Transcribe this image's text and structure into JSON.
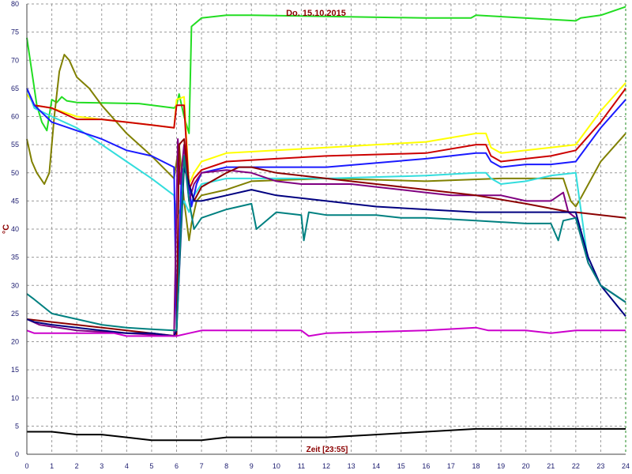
{
  "chart_data": {
    "type": "line",
    "title": "Do. 15.10.2015",
    "xlabel": "Zeit [23:55]",
    "ylabel": "°C",
    "xlim": [
      0,
      24
    ],
    "ylim": [
      0,
      80
    ],
    "xticks": [
      "0",
      "1",
      "2",
      "3",
      "4",
      "5",
      "6",
      "7",
      "8",
      "9",
      "10",
      "11",
      "12",
      "13",
      "14",
      "15",
      "16",
      "17",
      "18",
      "19",
      "20",
      "21",
      "22",
      "23",
      "24"
    ],
    "yticks": [
      "0",
      "5",
      "10",
      "15",
      "20",
      "25",
      "30",
      "35",
      "40",
      "45",
      "50",
      "55",
      "60",
      "65",
      "70",
      "75",
      "80"
    ],
    "grid": true,
    "series": [
      {
        "color": "#22dd22",
        "x": [
          0,
          0.2,
          0.4,
          0.6,
          0.8,
          1,
          1.2,
          1.4,
          1.6,
          2,
          4.5,
          5.9,
          6.0,
          6.1,
          6.3,
          6.5,
          6.6,
          7,
          8,
          9,
          16,
          17.8,
          18,
          22,
          22.2,
          23,
          24
        ],
        "y": [
          74,
          68,
          62,
          59,
          57.5,
          63,
          62.5,
          63.5,
          62.8,
          62.5,
          62.3,
          61.5,
          62,
          64,
          60,
          57,
          76,
          77.5,
          78,
          78,
          77.5,
          77.5,
          78,
          77,
          77.5,
          78,
          79.5
        ]
      },
      {
        "color": "#808000",
        "x": [
          0,
          0.2,
          0.4,
          0.7,
          0.9,
          1.1,
          1.3,
          1.5,
          1.7,
          2,
          2.5,
          3,
          4,
          5,
          5.9,
          6.1,
          6.3,
          6.5,
          6.6,
          6.8,
          7,
          8,
          9,
          12,
          16,
          19,
          21.5,
          21.8,
          22,
          22.2,
          23,
          24
        ],
        "y": [
          56,
          52,
          50,
          48,
          50,
          60,
          68,
          71,
          70,
          67,
          65,
          62,
          57,
          53,
          49,
          55,
          45,
          38,
          41,
          45,
          46,
          47,
          48.5,
          49,
          48.5,
          49,
          49,
          45,
          44,
          45.5,
          52,
          57
        ]
      },
      {
        "color": "#ffff00",
        "x": [
          0,
          0.3,
          1,
          2,
          3,
          4,
          5,
          5.9,
          6.0,
          6.3,
          6.5,
          6.7,
          7,
          8,
          10,
          12,
          16,
          18,
          18.4,
          18.6,
          19,
          20,
          21,
          22,
          23,
          24
        ],
        "y": [
          64,
          62,
          61.5,
          60,
          59.5,
          59,
          58.5,
          58,
          63,
          63.5,
          48,
          50,
          52,
          53.5,
          54,
          54.5,
          55.5,
          57,
          57,
          54.5,
          53.5,
          54,
          54.5,
          55,
          61,
          66
        ]
      },
      {
        "color": "#cc0000",
        "x": [
          0,
          0.3,
          1,
          2,
          3,
          4,
          5,
          5.9,
          6.0,
          6.3,
          6.5,
          6.7,
          7,
          8,
          10,
          12,
          16,
          18,
          18.4,
          18.6,
          19,
          20,
          21,
          22,
          23,
          24
        ],
        "y": [
          65,
          62,
          61.5,
          59.5,
          59.5,
          59,
          58.5,
          58,
          62,
          62,
          47,
          49,
          50.5,
          52,
          52.5,
          53,
          53.5,
          55,
          55,
          53,
          52,
          52.5,
          53,
          54,
          59,
          65
        ]
      },
      {
        "color": "#33dddd",
        "x": [
          0,
          0.3,
          1,
          2,
          3,
          4,
          5,
          5.9,
          6.0,
          6.3,
          6.5,
          6.7,
          7,
          8,
          10,
          12,
          16,
          18,
          18.4,
          18.6,
          19,
          20,
          21,
          22,
          22.5,
          23,
          24
        ],
        "y": [
          65,
          61.5,
          60,
          58,
          55,
          52,
          49,
          46,
          42,
          45,
          43,
          46,
          48,
          49,
          49,
          49,
          49.5,
          50,
          50,
          49,
          48,
          48.5,
          49.5,
          50,
          34,
          30,
          27
        ]
      },
      {
        "color": "#1a1aff",
        "x": [
          0,
          0.3,
          1,
          2,
          3,
          4,
          5,
          5.9,
          6.0,
          6.2,
          6.4,
          6.6,
          6.8,
          7,
          8,
          10,
          12,
          16,
          18,
          18.4,
          18.6,
          19,
          20,
          21,
          22,
          23,
          24
        ],
        "y": [
          65,
          62,
          59,
          57.5,
          56,
          54,
          53,
          51,
          22,
          50,
          52,
          44,
          48,
          50,
          51,
          51,
          51,
          52.5,
          53.5,
          53.5,
          52,
          51,
          51.5,
          51.5,
          52,
          58,
          63
        ]
      },
      {
        "color": "#800080",
        "x": [
          0,
          0.5,
          2,
          4,
          5.9,
          6.05,
          6.15,
          6.3,
          6.5,
          6.7,
          7,
          8,
          9,
          10,
          11,
          12,
          13,
          14,
          15,
          16,
          17,
          18,
          19,
          20,
          21,
          21.5,
          21.7,
          22,
          22.5,
          23,
          24
        ],
        "y": [
          24,
          23,
          22,
          21.5,
          21,
          56,
          48,
          55,
          45,
          48,
          50,
          50.5,
          50,
          48.5,
          48,
          48,
          48,
          47.5,
          47,
          46.5,
          46,
          46,
          46,
          45,
          45,
          46.5,
          43,
          42,
          34,
          30,
          27
        ]
      },
      {
        "color": "#8b0000",
        "x": [
          0,
          6.0,
          6.1,
          6.3,
          6.5,
          6.7,
          7,
          8,
          8.5,
          9,
          10,
          12,
          14,
          16,
          18,
          20,
          21.8,
          22,
          24
        ],
        "y": [
          24,
          21,
          55,
          56,
          48,
          45,
          47.5,
          50,
          51,
          51,
          50,
          49,
          48,
          47,
          46,
          44.5,
          43,
          43,
          42
        ]
      },
      {
        "color": "#000080",
        "x": [
          0,
          0.3,
          1,
          2,
          3,
          4,
          5,
          5.9,
          6.0,
          6.3,
          6.5,
          6.7,
          7,
          8,
          9,
          10,
          12,
          14,
          16,
          18,
          20,
          21.5,
          22,
          22.5,
          23,
          24
        ],
        "y": [
          24,
          23.5,
          23,
          22.5,
          22,
          21.5,
          21.5,
          21,
          22,
          51,
          48,
          45,
          45,
          46,
          47,
          46,
          45,
          44,
          43.5,
          43,
          43,
          43,
          43,
          35,
          30,
          24.5
        ]
      },
      {
        "color": "#008080",
        "x": [
          0,
          0.3,
          1,
          2,
          3,
          4,
          5,
          5.9,
          6.0,
          6.3,
          6.5,
          6.7,
          7,
          8,
          9,
          9.2,
          10,
          11,
          11.1,
          11.3,
          12,
          14,
          15,
          16,
          18,
          20,
          21,
          21.3,
          21.5,
          22,
          22.5,
          23,
          24
        ],
        "y": [
          28.5,
          27.5,
          25,
          24,
          23,
          22.5,
          22.2,
          22,
          22,
          53,
          45,
          40,
          42,
          43.5,
          44.5,
          40,
          43,
          42.5,
          38,
          43,
          42.5,
          42.5,
          42,
          42,
          41.5,
          41,
          41,
          38,
          41.5,
          42,
          34,
          30,
          27
        ]
      },
      {
        "color": "#cc00cc",
        "x": [
          0,
          0.3,
          1,
          2,
          3,
          3.5,
          4,
          5,
          6,
          6.5,
          7,
          10,
          11,
          11.3,
          12,
          16,
          18,
          18.5,
          19,
          20,
          21,
          22,
          23,
          24
        ],
        "y": [
          22,
          21.5,
          21.5,
          21.5,
          21.5,
          21.5,
          21,
          21,
          21,
          21.5,
          22,
          22,
          22,
          21,
          21.5,
          22,
          22.5,
          22,
          22,
          22,
          21.5,
          22,
          22,
          22
        ]
      },
      {
        "color": "#000000",
        "x": [
          0,
          1,
          2,
          3,
          4,
          5,
          6,
          7,
          8,
          10,
          12,
          14,
          16,
          18,
          19,
          20,
          22,
          23,
          24
        ],
        "y": [
          4,
          4,
          3.5,
          3.5,
          3,
          2.5,
          2.5,
          2.5,
          3,
          3,
          3,
          3.5,
          4,
          4.5,
          4.5,
          4.5,
          4.5,
          4.5,
          4.5
        ]
      }
    ]
  }
}
